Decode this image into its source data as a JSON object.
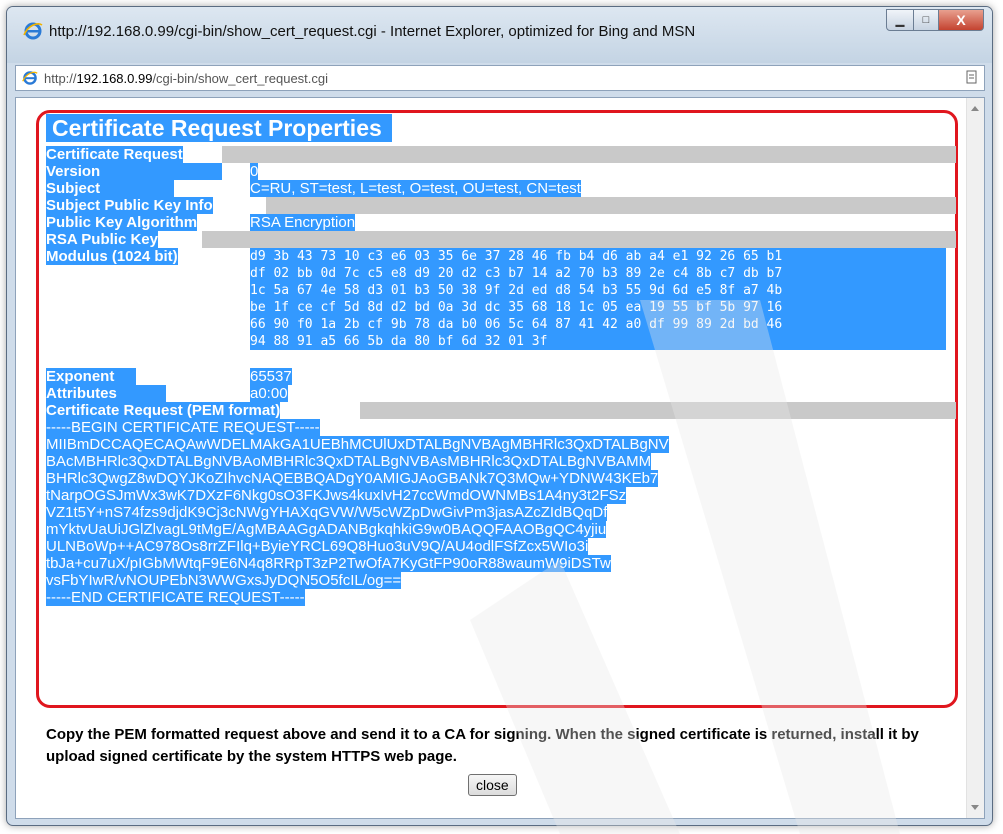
{
  "window": {
    "title": "http://192.168.0.99/cgi-bin/show_cert_request.cgi - Internet Explorer, optimized for Bing and MSN",
    "controls": {
      "minimize": "▁",
      "maximize": "□",
      "close": "X"
    }
  },
  "address_bar": {
    "prefix": "http://",
    "host": "192.168.0.99",
    "path": "/cgi-bin/show_cert_request.cgi"
  },
  "page": {
    "heading": "Certificate Request Properties",
    "section_title": "Certificate Request",
    "version_label": "Version",
    "version_value": "0",
    "subject_label": "Subject",
    "subject_value": "C=RU, ST=test, L=test, O=test, OU=test, CN=test",
    "spki_label": "Subject Public Key Info",
    "algorithm_label": "Public Key Algorithm",
    "algorithm_value": "RSA Encryption",
    "rsa_label": "RSA Public Key",
    "modulus_label": "Modulus (1024 bit)",
    "modulus_lines": [
      "d9 3b 43 73 10 c3 e6 03 35 6e 37 28 46 fb b4 d6 ab a4 e1 92 26 65 b1",
      "df 02 bb 0d 7c c5 e8 d9 20 d2 c3 b7 14 a2 70 b3 89 2e c4 8b c7 db b7",
      "1c 5a 67 4e 58 d3 01 b3 50 38 9f 2d ed d8 54 b3 55 9d 6d e5 8f a7 4b",
      "be 1f ce cf 5d 8d d2 bd 0a 3d dc 35 68 18 1c 05 ea 19 55 bf 5b 97 16",
      "66 90 f0 1a 2b cf 9b 78 da b0 06 5c 64 87 41 42 a0 df 99 89 2d bd 46",
      "94 88 91 a5 66 5b da 80 bf 6d 32 01 3f"
    ],
    "exponent_label": "Exponent",
    "exponent_value": "65537",
    "attributes_label": "Attributes",
    "attributes_value": "a0:00",
    "pem_label": "Certificate Request (PEM format)",
    "pem_lines": [
      "-----BEGIN CERTIFICATE REQUEST-----",
      "MIIBmDCCAQECAQAwWDELMAkGA1UEBhMCUlUxDTALBgNVBAgMBHRlc3QxDTALBgNV",
      "BAcMBHRlc3QxDTALBgNVBAoMBHRlc3QxDTALBgNVBAsMBHRlc3QxDTALBgNVBAMM",
      "BHRlc3QwgZ8wDQYJKoZIhvcNAQEBBQADgY0AMIGJAoGBANk7Q3MQw+YDNW43KEb7",
      "tNarpOGSJmWx3wK7DXzF6Nkg0sO3FKJws4kuxIvH27ccWmdOWNMBs1A4ny3t2FSz",
      "VZ1t5Y+nS74fzs9djdK9Cj3cNWgYHAXqGVW/W5cWZpDwGivPm3jasAZcZIdBQqDf",
      "mYktvUaUiJGlZlvagL9tMgE/AgMBAAGgADANBgkqhkiG9w0BAQQFAAOBgQC4yjiu",
      "ULNBoWp++AC978Os8rrZFIlq+ByieYRCL69Q8Huo3uV9Q/AU4odlFSfZcx5WIo3i",
      "tbJa+cu7uX/pIGbMWtqF9E6N4q8RRpT3zP2TwOfA7KyGtFP90oR88waumW9iDSTw",
      "vsFbYIwR/vNOUPEbN3WWGxsJyDQN5O5fcIL/og==",
      "-----END CERTIFICATE REQUEST-----"
    ],
    "note": "Copy the PEM formatted request above and send it to a CA for signing. When the signed certificate is returned, install it by upload signed certificate by the system HTTPS web page.",
    "close_label": "close"
  }
}
